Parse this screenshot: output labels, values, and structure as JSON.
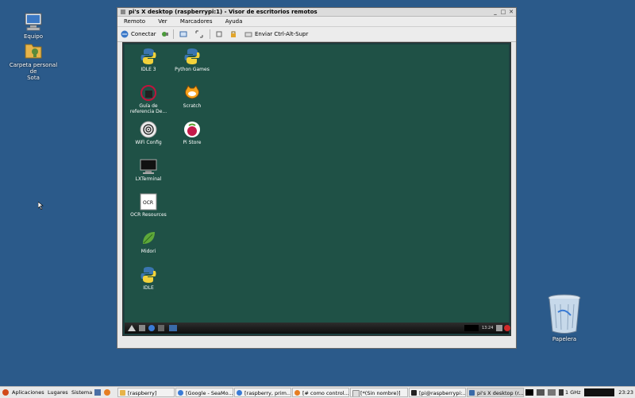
{
  "desktop": {
    "icons": [
      {
        "label": "Equipo",
        "icon": "computer-icon"
      },
      {
        "label": "Carpeta personal de",
        "label2": "Sota",
        "icon": "home-folder-icon"
      },
      {
        "label": "Papelera",
        "icon": "trash-icon"
      }
    ]
  },
  "window": {
    "title": "pi's X desktop (raspberrypi:1) - Visor de escritorios remotos",
    "menu": [
      "Remoto",
      "Ver",
      "Marcadores",
      "Ayuda"
    ],
    "toolbar": {
      "connect_label": "Conectar",
      "send_cad_label": "Enviar Ctrl-Alt-Supr"
    }
  },
  "remote": {
    "icons": [
      {
        "label": "IDLE 3"
      },
      {
        "label": "Python Games"
      },
      {
        "label": "Guía de",
        "label2": "referencia De..."
      },
      {
        "label": "Scratch"
      },
      {
        "label": "WiFi Config"
      },
      {
        "label": "Pi Store"
      },
      {
        "label": "LXTerminal"
      },
      {
        "label": "OCR Resources"
      },
      {
        "label": "Midori"
      },
      {
        "label": "IDLE"
      }
    ],
    "panel_time": "13:24"
  },
  "panel": {
    "menus": [
      "Aplicaciones",
      "Lugares",
      "Sistema"
    ],
    "tasks": [
      "[raspberry]",
      "[Google - SeaMo...",
      "[raspberry, prim...",
      "[# como control...",
      "[*(Sin nombre)]",
      "[pi@raspberrypi:...",
      "pi's X desktop (r..."
    ],
    "cpu": "1 GHz",
    "clock": "23:23"
  },
  "colors": {
    "desktop_bg": "#2b5a8a",
    "remote_bg": "#1f5146"
  }
}
